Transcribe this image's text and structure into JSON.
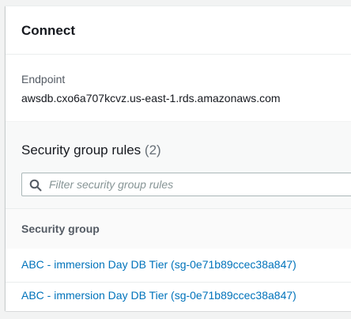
{
  "panel": {
    "title": "Connect"
  },
  "endpoint": {
    "label": "Endpoint",
    "value": "awsdb.cxo6a707kcvz.us-east-1.rds.amazonaws.com"
  },
  "security_group_rules": {
    "heading": "Security group rules",
    "count": "(2)",
    "filter": {
      "placeholder": "Filter security group rules",
      "value": ""
    },
    "columns": [
      "Security group"
    ],
    "rows": [
      {
        "security_group": "ABC - immersion Day DB Tier (sg-0e71b89ccec38a847)"
      },
      {
        "security_group": "ABC - immersion Day DB Tier (sg-0e71b89ccec38a847)"
      }
    ]
  },
  "icons": {
    "filter": "search-icon"
  },
  "colors": {
    "link": "#0073bb",
    "background": "#f2f3f3",
    "panel": "#ffffff"
  }
}
